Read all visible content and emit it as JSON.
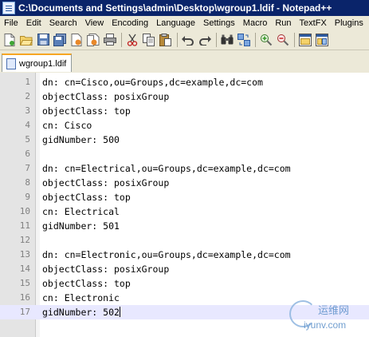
{
  "window": {
    "title": "C:\\Documents and Settings\\admin\\Desktop\\wgroup1.ldif - Notepad++"
  },
  "menu": [
    "File",
    "Edit",
    "Search",
    "View",
    "Encoding",
    "Language",
    "Settings",
    "Macro",
    "Run",
    "TextFX",
    "Plugins"
  ],
  "toolbar": {
    "icons": [
      "new-file-icon",
      "open-file-icon",
      "save-icon",
      "save-all-icon",
      "close-icon",
      "close-all-icon",
      "print-icon",
      "cut-icon",
      "copy-icon",
      "paste-icon",
      "undo-icon",
      "redo-icon",
      "find-icon",
      "replace-icon",
      "zoom-in-icon",
      "zoom-out-icon",
      "sync-vertical-icon",
      "sync-horizontal-icon"
    ]
  },
  "tabs": [
    {
      "label": "wgroup1.ldif"
    }
  ],
  "editor": {
    "current_line": 17,
    "lines": [
      {
        "num": "1",
        "text": "dn: cn=Cisco,ou=Groups,dc=example,dc=com"
      },
      {
        "num": "2",
        "text": "objectClass: posixGroup"
      },
      {
        "num": "3",
        "text": "objectClass: top"
      },
      {
        "num": "4",
        "text": "cn: Cisco"
      },
      {
        "num": "5",
        "text": "gidNumber: 500"
      },
      {
        "num": "6",
        "text": ""
      },
      {
        "num": "7",
        "text": "dn: cn=Electrical,ou=Groups,dc=example,dc=com"
      },
      {
        "num": "8",
        "text": "objectClass: posixGroup"
      },
      {
        "num": "9",
        "text": "objectClass: top"
      },
      {
        "num": "10",
        "text": "cn: Electrical"
      },
      {
        "num": "11",
        "text": "gidNumber: 501"
      },
      {
        "num": "12",
        "text": ""
      },
      {
        "num": "13",
        "text": "dn: cn=Electronic,ou=Groups,dc=example,dc=com"
      },
      {
        "num": "14",
        "text": "objectClass: posixGroup"
      },
      {
        "num": "15",
        "text": "objectClass: top"
      },
      {
        "num": "16",
        "text": "cn: Electronic"
      },
      {
        "num": "17",
        "text": "gidNumber: 502"
      }
    ]
  },
  "watermark": {
    "text_cn": "运维网",
    "url": "iyunv.com"
  },
  "colors": {
    "title_bar": "#0a246a",
    "chrome": "#ece9d8",
    "gutter": "#e4e4e4",
    "current_line": "#e8e8ff",
    "tab_accent": "#f6a623"
  }
}
